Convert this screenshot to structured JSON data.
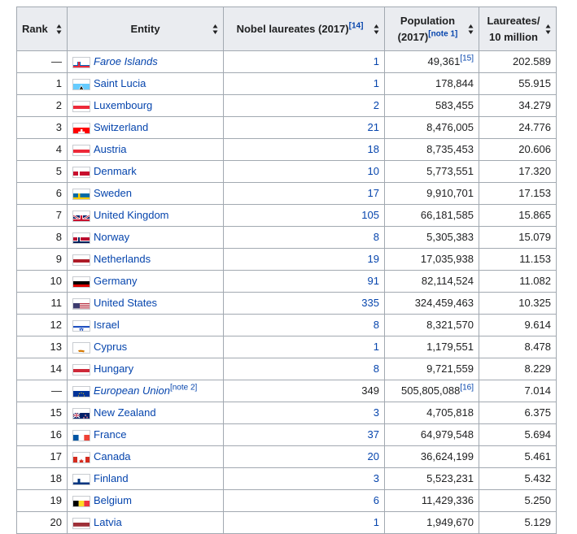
{
  "headers": {
    "rank": "Rank",
    "entity": "Entity",
    "laureates": "Nobel laureates (2017)",
    "laureates_ref": "[14]",
    "population_line1": "Population",
    "population_line2": "(2017)",
    "population_ref": "[note 1]",
    "per_line1": "Laureates/",
    "per_line2": "10 million"
  },
  "rows": [
    {
      "rank": "—",
      "entity": "Faroe Islands",
      "italic": true,
      "flag": "faroe",
      "laureates": "1",
      "laureates_link": true,
      "population": "49,361",
      "pop_ref": "[15]",
      "per": "202.589"
    },
    {
      "rank": "1",
      "entity": "Saint Lucia",
      "flag": "stlucia",
      "laureates": "1",
      "laureates_link": true,
      "population": "178,844",
      "per": "55.915"
    },
    {
      "rank": "2",
      "entity": "Luxembourg",
      "flag": "luxembourg",
      "laureates": "2",
      "laureates_link": true,
      "population": "583,455",
      "per": "34.279"
    },
    {
      "rank": "3",
      "entity": "Switzerland",
      "flag": "switzerland",
      "laureates": "21",
      "laureates_link": true,
      "population": "8,476,005",
      "per": "24.776"
    },
    {
      "rank": "4",
      "entity": "Austria",
      "flag": "austria",
      "laureates": "18",
      "laureates_link": true,
      "population": "8,735,453",
      "per": "20.606"
    },
    {
      "rank": "5",
      "entity": "Denmark",
      "flag": "denmark",
      "laureates": "10",
      "laureates_link": true,
      "population": "5,773,551",
      "per": "17.320"
    },
    {
      "rank": "6",
      "entity": "Sweden",
      "flag": "sweden",
      "laureates": "17",
      "laureates_link": true,
      "population": "9,910,701",
      "per": "17.153"
    },
    {
      "rank": "7",
      "entity": "United Kingdom",
      "flag": "uk",
      "laureates": "105",
      "laureates_link": true,
      "population": "66,181,585",
      "per": "15.865"
    },
    {
      "rank": "8",
      "entity": "Norway",
      "flag": "norway",
      "laureates": "8",
      "laureates_link": true,
      "population": "5,305,383",
      "per": "15.079"
    },
    {
      "rank": "9",
      "entity": "Netherlands",
      "flag": "netherlands",
      "laureates": "19",
      "laureates_link": true,
      "population": "17,035,938",
      "per": "11.153"
    },
    {
      "rank": "10",
      "entity": "Germany",
      "flag": "germany",
      "laureates": "91",
      "laureates_link": true,
      "population": "82,114,524",
      "per": "11.082"
    },
    {
      "rank": "11",
      "entity": "United States",
      "flag": "usa",
      "laureates": "335",
      "laureates_link": true,
      "population": "324,459,463",
      "per": "10.325"
    },
    {
      "rank": "12",
      "entity": "Israel",
      "flag": "israel",
      "laureates": "8",
      "laureates_link": true,
      "population": "8,321,570",
      "per": "9.614"
    },
    {
      "rank": "13",
      "entity": "Cyprus",
      "flag": "cyprus",
      "laureates": "1",
      "laureates_link": true,
      "population": "1,179,551",
      "per": "8.478"
    },
    {
      "rank": "14",
      "entity": "Hungary",
      "flag": "hungary",
      "laureates": "8",
      "laureates_link": true,
      "population": "9,721,559",
      "per": "8.229"
    },
    {
      "rank": "—",
      "entity": "European Union",
      "italic": true,
      "entity_ref": "[note 2]",
      "flag": "eu",
      "laureates": "349",
      "laureates_link": false,
      "population": "505,805,088",
      "pop_ref": "[16]",
      "per": "7.014"
    },
    {
      "rank": "15",
      "entity": "New Zealand",
      "flag": "nz",
      "laureates": "3",
      "laureates_link": true,
      "population": "4,705,818",
      "per": "6.375"
    },
    {
      "rank": "16",
      "entity": "France",
      "flag": "france",
      "laureates": "37",
      "laureates_link": true,
      "population": "64,979,548",
      "per": "5.694"
    },
    {
      "rank": "17",
      "entity": "Canada",
      "flag": "canada",
      "laureates": "20",
      "laureates_link": true,
      "population": "36,624,199",
      "per": "5.461"
    },
    {
      "rank": "18",
      "entity": "Finland",
      "flag": "finland",
      "laureates": "3",
      "laureates_link": true,
      "population": "5,523,231",
      "per": "5.432"
    },
    {
      "rank": "19",
      "entity": "Belgium",
      "flag": "belgium",
      "laureates": "6",
      "laureates_link": true,
      "population": "11,429,336",
      "per": "5.250"
    },
    {
      "rank": "20",
      "entity": "Latvia",
      "flag": "latvia",
      "laureates": "1",
      "laureates_link": true,
      "population": "1,949,670",
      "per": "5.129"
    }
  ]
}
